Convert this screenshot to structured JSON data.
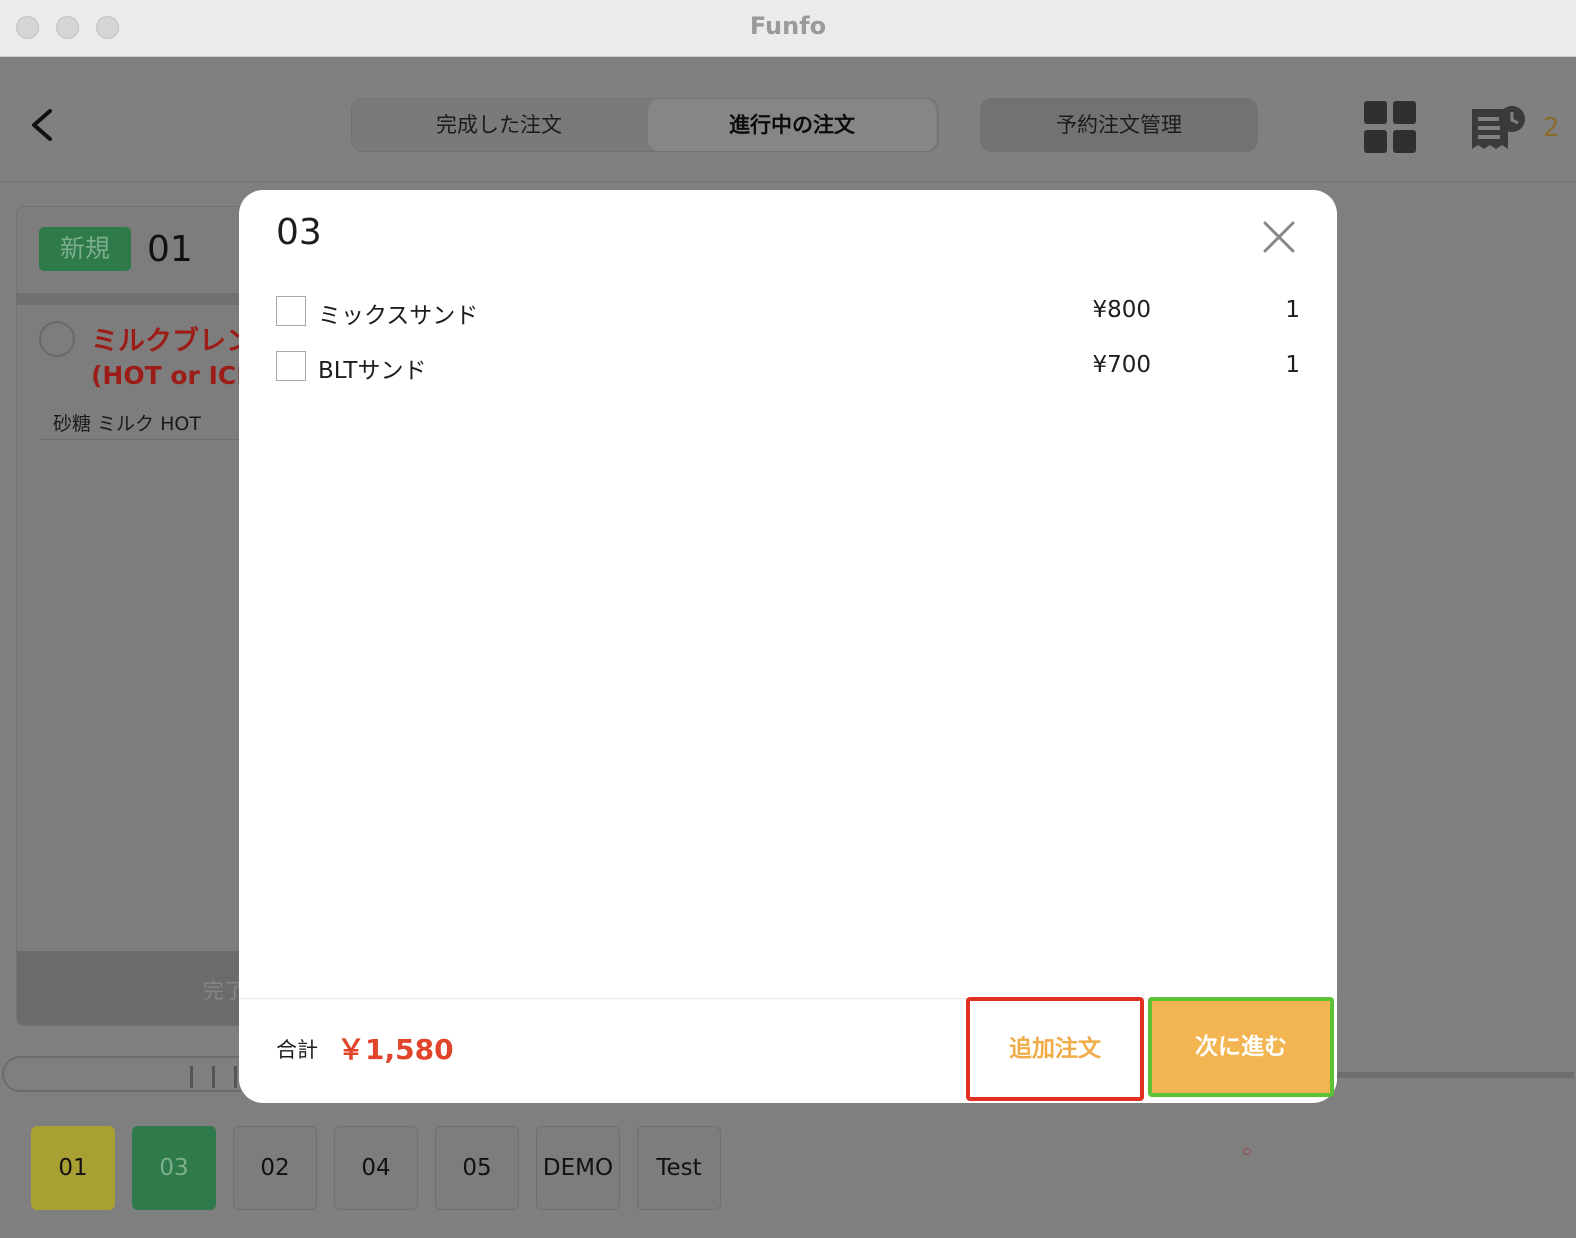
{
  "window": {
    "title": "Funfo"
  },
  "header": {
    "tabs": [
      {
        "label": "完成した注文"
      },
      {
        "label": "進行中の注文"
      }
    ],
    "reservation_label": "予約注文管理",
    "receipt_count": "2"
  },
  "order_card": {
    "status": "新規",
    "number": "01",
    "item_name_line1": "ミルクブレン",
    "item_name_line2": "(HOT or ICE",
    "item_options": "砂糖 ミルク HOT",
    "footer_label": "完了"
  },
  "table_tabs": [
    "01",
    "03",
    "02",
    "04",
    "05",
    "DEMO",
    "Test"
  ],
  "modal": {
    "title": "03",
    "items": [
      {
        "name": "ミックスサンド",
        "price": "¥800",
        "qty": "1"
      },
      {
        "name": "BLTサンド",
        "price": "¥700",
        "qty": "1"
      }
    ],
    "total_label": "合計",
    "total_value": "￥1,580",
    "add_order_label": "追加注文",
    "next_label": "次に進む"
  },
  "colors": {
    "accent_orange": "#f2b552",
    "total_red": "#e0442a",
    "highlight_red": "#e23024",
    "highlight_green": "#5ac234",
    "new_badge_green": "#2e7a4b"
  }
}
